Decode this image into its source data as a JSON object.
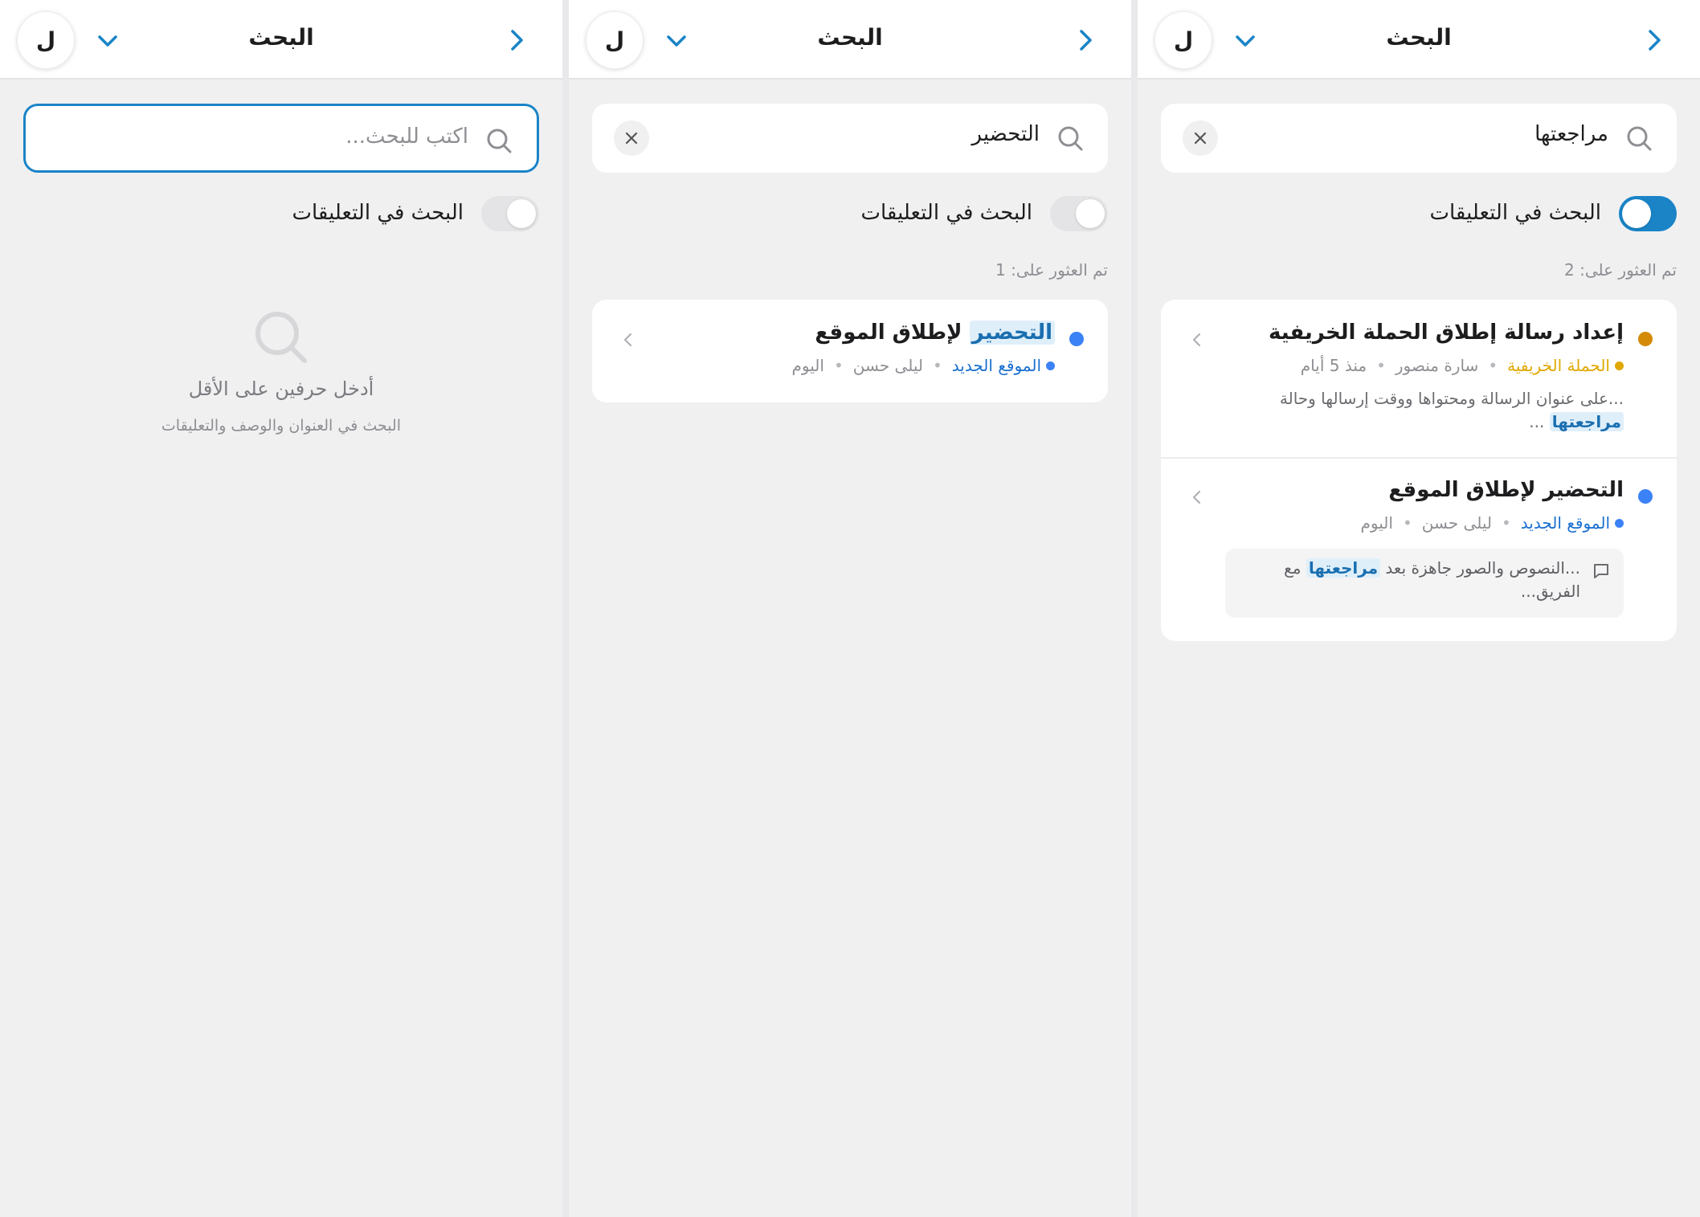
{
  "colors": {
    "accent": "#1a84c7",
    "blue_dot": "#3b82f6",
    "orange_dot": "#d48a06",
    "orange_text": "#e0a800"
  },
  "avatar_letter": "ل",
  "header_title": "البحث",
  "toggle_label": "البحث في التعليقات",
  "panel1": {
    "search_placeholder": "اكتب للبحث...",
    "toggle_on": false,
    "empty_title": "أدخل حرفين على الأقل",
    "empty_subtitle": "البحث في العنوان والوصف والتعليقات"
  },
  "panel2": {
    "search_value": "التحضير",
    "toggle_on": false,
    "found_label": "تم العثور على: 1",
    "results": [
      {
        "title_highlight": "التحضير",
        "title_rest": " لإطلاق الموقع",
        "project": "الموقع الجديد",
        "assignee": "ليلى حسن",
        "date": "اليوم"
      }
    ]
  },
  "panel3": {
    "search_value": "مراجعتها",
    "toggle_on": true,
    "found_label": "تم العثور على: 2",
    "results": [
      {
        "title": "إعداد رسالة إطلاق الحملة الخريفية",
        "project": "الحملة الخريفية",
        "assignee": "سارة منصور",
        "date": "منذ 5 أيام",
        "desc_before": "...على عنوان الرسالة ومحتواها ووقت إرسالها وحالة ",
        "desc_highlight": "مراجعتها",
        "desc_after": " ..."
      },
      {
        "title": "التحضير لإطلاق الموقع",
        "project": "الموقع الجديد",
        "assignee": "ليلى حسن",
        "date": "اليوم",
        "comment_before": "...النصوص والصور جاهزة بعد ",
        "comment_highlight": "مراجعتها",
        "comment_after": " مع الفريق..."
      }
    ]
  }
}
